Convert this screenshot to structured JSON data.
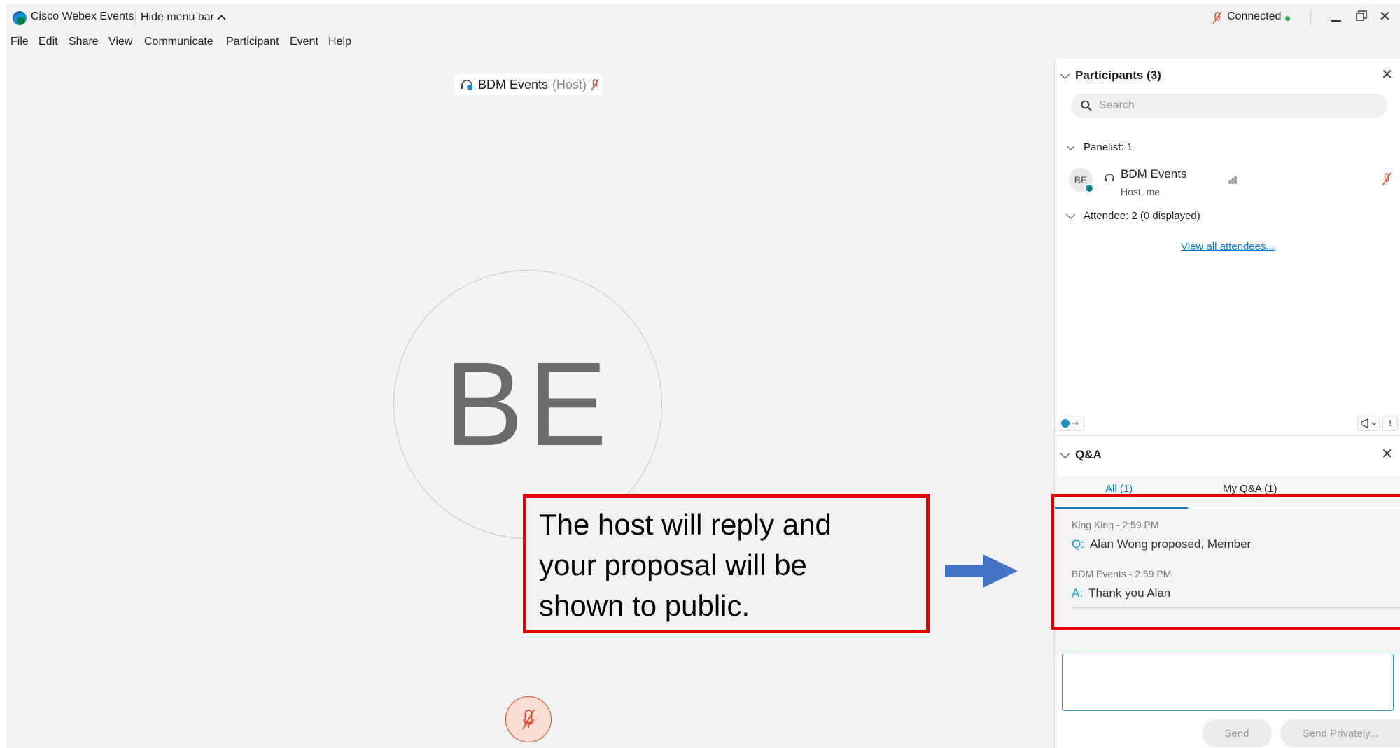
{
  "app": {
    "title": "Cisco Webex Events",
    "hide_menu": "Hide menu bar"
  },
  "status": {
    "connected": "Connected"
  },
  "menu": [
    "File",
    "Edit",
    "Share",
    "View",
    "Communicate",
    "Participant",
    "Event",
    "Help"
  ],
  "stage": {
    "name_chip_name": "BDM Events",
    "name_chip_role": "(Host)",
    "initials": "BE"
  },
  "callout": {
    "text_line1": "The host will reply and",
    "text_line2": "your proposal will be",
    "text_line3": "shown to public."
  },
  "participants": {
    "header": "Participants (3)",
    "search_placeholder": "Search",
    "panelist_label": "Panelist: 1",
    "panelist": {
      "initials": "BE",
      "name": "BDM Events",
      "role": "Host, me"
    },
    "attendee_label": "Attendee: 2 (0 displayed)",
    "view_all": "View all attendees..."
  },
  "qa": {
    "header": "Q&A",
    "tabs": [
      "All (1)",
      "My Q&A (1)"
    ],
    "items": [
      {
        "meta": "King King - 2:59 PM",
        "prefix": "Q:",
        "text": "Alan Wong proposed, Member"
      },
      {
        "meta": "BDM Events - 2:59 PM",
        "prefix": "A:",
        "text": "Thank you Alan"
      }
    ],
    "send": "Send",
    "send_privately": "Send Privately..."
  },
  "colors": {
    "accent": "#0a7fd1",
    "highlight": "#e60000",
    "mute_red": "#d94a34",
    "arrow": "#4472c4"
  }
}
